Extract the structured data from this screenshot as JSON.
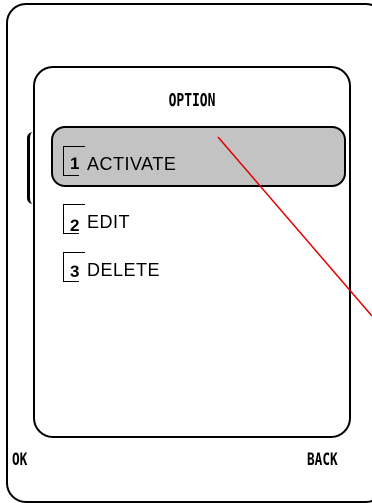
{
  "screen": {
    "title": "OPTION",
    "menu": [
      {
        "number": "1",
        "label": "ACTIVATE",
        "selected": true
      },
      {
        "number": "2",
        "label": "EDIT",
        "selected": false
      },
      {
        "number": "3",
        "label": "DELETE",
        "selected": false
      }
    ],
    "softkeys": {
      "left": "OK",
      "right": "BACK"
    }
  },
  "colors": {
    "highlight": "#c3c3c3",
    "pointer_line": "#e00000",
    "border": "#000000"
  }
}
